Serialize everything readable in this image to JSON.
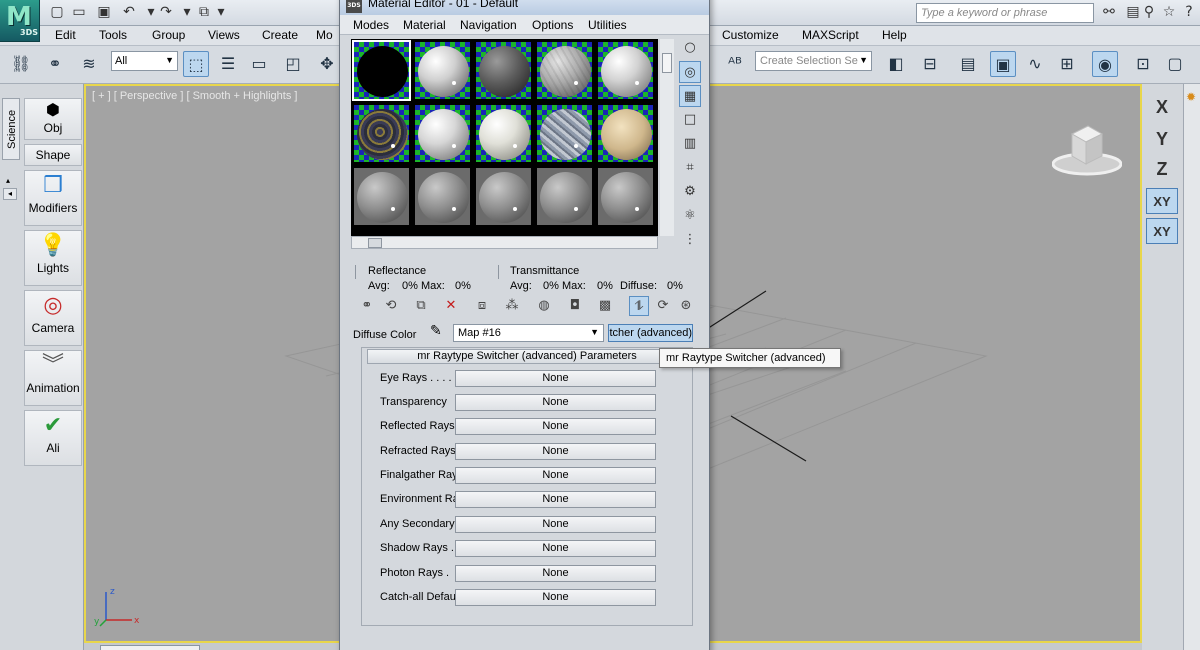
{
  "app": {
    "logo_text": "3DS"
  },
  "search": {
    "placeholder": "Type a keyword or phrase"
  },
  "menubar": {
    "items": [
      "Edit",
      "Tools",
      "Group",
      "Views",
      "Create",
      "Mo",
      "Customize",
      "MAXScript",
      "Help"
    ]
  },
  "toolbar": {
    "filter_value": "All",
    "selection_set_placeholder": "Create Selection Se"
  },
  "command_panel": {
    "vertical_tab": "Science",
    "buttons": [
      "Obj",
      "Shape",
      "Modifiers",
      "Lights",
      "Camera",
      "Animation",
      "Ali"
    ]
  },
  "viewport": {
    "label": "[ + ] [ Perspective ] [ Smooth + Highlights ]",
    "active_border_color": "#e8d64b"
  },
  "axes": {
    "x": "X",
    "y": "Y",
    "z": "Z",
    "xy": "XY",
    "xy_alt": "XY"
  },
  "tripod": {
    "x": "x",
    "y": "y",
    "z": "z"
  },
  "material_editor": {
    "title": "Material Editor - 01 - Default",
    "menu": [
      "Modes",
      "Material",
      "Navigation",
      "Options",
      "Utilities"
    ],
    "reflectance": {
      "title": "Reflectance",
      "avg": "Avg:",
      "avg_val": "0%",
      "max": "Max:",
      "max_val": "0%"
    },
    "transmittance": {
      "title": "Transmittance",
      "avg": "Avg:",
      "avg_val": "0%",
      "max": "Max:",
      "max_val": "0%",
      "diffuse": "Diffuse:",
      "diffuse_val": "0%"
    },
    "diffuse_color_label": "Diffuse Color",
    "map_value": "Map #16",
    "type_button": "mr Raytype Switcher (advanced)",
    "rollout_title": "mr Raytype Switcher (advanced) Parameters",
    "params": [
      {
        "label": "Eye Rays . . . .",
        "value": "None"
      },
      {
        "label": "Transparency",
        "value": "None"
      },
      {
        "label": "Reflected Rays",
        "value": "None"
      },
      {
        "label": "Refracted Rays",
        "value": "None"
      },
      {
        "label": "Finalgather Rays",
        "value": "None"
      },
      {
        "label": "Environment Rays",
        "value": "None"
      },
      {
        "label": "Any Secondary",
        "value": "None"
      },
      {
        "label": "Shadow Rays .",
        "value": "None"
      },
      {
        "label": "Photon Rays .",
        "value": "None"
      },
      {
        "label": "Catch-all Default",
        "value": "None"
      }
    ]
  },
  "tooltip": {
    "text": "mr Raytype Switcher (advanced)"
  }
}
